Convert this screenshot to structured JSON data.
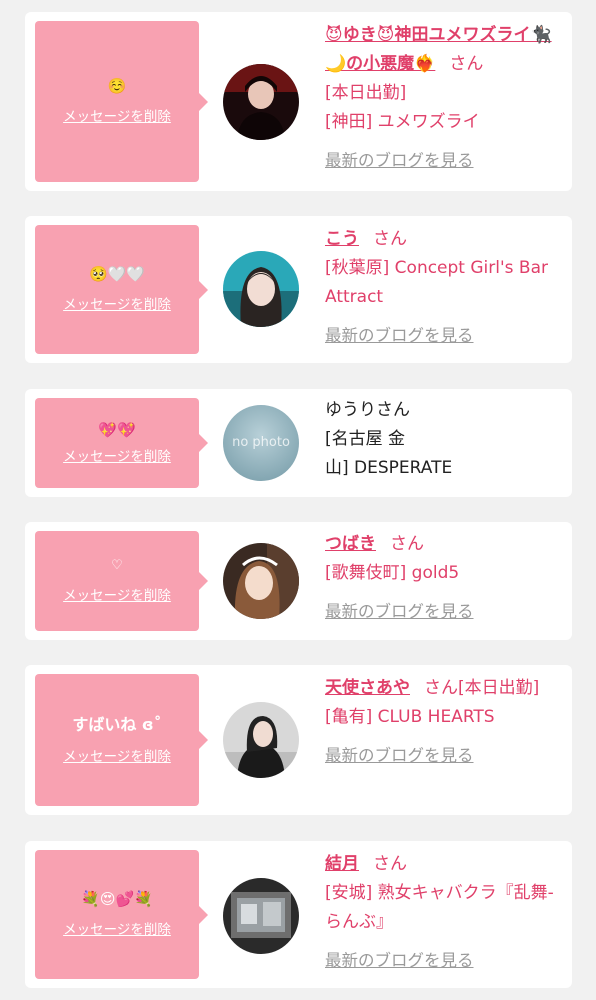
{
  "cards": [
    {
      "message": "☺️",
      "delete_label": "メッセージを削除",
      "name": "😈ゆき😈神田ユメワズライ🐈‍⬛🌙の小悪魔❤️‍🔥",
      "suffix": "さん",
      "lines": [
        "[本日出勤]",
        "[神田] ユメワズライ"
      ],
      "blog_label": "最新のブログを見る"
    },
    {
      "message": "🥺🤍🤍",
      "delete_label": "メッセージを削除",
      "name": "こう",
      "suffix": "さん",
      "lines": [
        "[秋葉原] Concept Girl's Bar Attract"
      ],
      "blog_label": "最新のブログを見る"
    },
    {
      "message": "💖💖",
      "delete_label": "メッセージを削除",
      "name": "ゆうりさん",
      "lines": [
        "[名古屋 金",
        "山] DESPERATE"
      ],
      "avatar_text": "no photo"
    },
    {
      "message": "♡",
      "delete_label": "メッセージを削除",
      "name": "つばき",
      "suffix": "さん",
      "lines": [
        "[歌舞伎町] gold5"
      ],
      "blog_label": "最新のブログを見る"
    },
    {
      "message": "すばいね ɞ˚",
      "delete_label": "メッセージを削除",
      "name": "天使さあや",
      "suffix": "さん[本日出勤]",
      "lines": [
        "[亀有] CLUB HEARTS"
      ],
      "blog_label": "最新のブログを見る"
    },
    {
      "message": "💐😍💕💐",
      "delete_label": "メッセージを削除",
      "name": "結月",
      "suffix": "さん",
      "lines": [
        "[安城] 熟女キャバクラ『乱舞-らんぶ』"
      ],
      "blog_label": "最新のブログを見る"
    }
  ],
  "colors": {
    "accent": "#e0406a",
    "bubble": "#f8a1b1",
    "background": "#f1f1f1"
  }
}
